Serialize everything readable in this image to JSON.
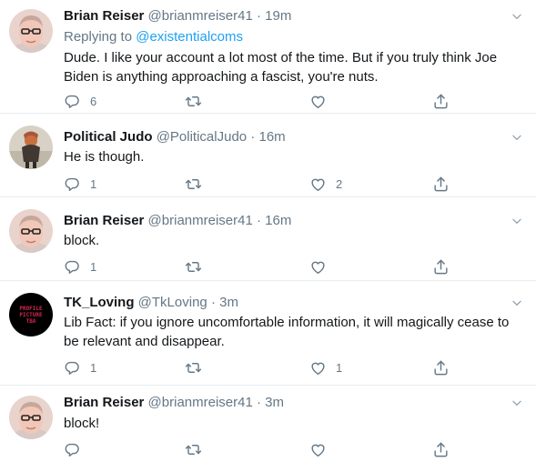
{
  "tweets": [
    {
      "name": "Brian Reiser",
      "handle": "@brianmreiser41",
      "sep": "·",
      "time": "19m",
      "replying_label": "Replying to",
      "replying_to": "@existentialcoms",
      "text_line1": "Dude. I like your account a lot most of the time. But if you truly think Joe",
      "text_line2": "Biden is anything approaching a fascist, you're nuts.",
      "reply_count": "6",
      "retweet_count": "",
      "like_count": ""
    },
    {
      "name": "Political Judo",
      "handle": "@PoliticalJudo",
      "sep": "·",
      "time": "16m",
      "text_line1": "He is though.",
      "reply_count": "1",
      "retweet_count": "",
      "like_count": "2"
    },
    {
      "name": "Brian Reiser",
      "handle": "@brianmreiser41",
      "sep": "·",
      "time": "16m",
      "text_line1": "block.",
      "reply_count": "1",
      "retweet_count": "",
      "like_count": ""
    },
    {
      "name": "TK_Loving",
      "handle": "@TkLoving",
      "sep": "·",
      "time": "3m",
      "avatar_text": [
        "PROFILE",
        "PICTURE",
        "TBA"
      ],
      "text_line1": "Lib Fact: if you ignore uncomfortable information, it will magically cease to",
      "text_line2": "be relevant and disappear.",
      "reply_count": "1",
      "retweet_count": "",
      "like_count": "1"
    },
    {
      "name": "Brian Reiser",
      "handle": "@brianmreiser41",
      "sep": "·",
      "time": "3m",
      "text_line1": "block!",
      "reply_count": "",
      "retweet_count": "",
      "like_count": ""
    }
  ],
  "colors": {
    "text": "#14171a",
    "meta": "#657786",
    "link": "#1da1f2",
    "divider": "#e6ecf0"
  }
}
